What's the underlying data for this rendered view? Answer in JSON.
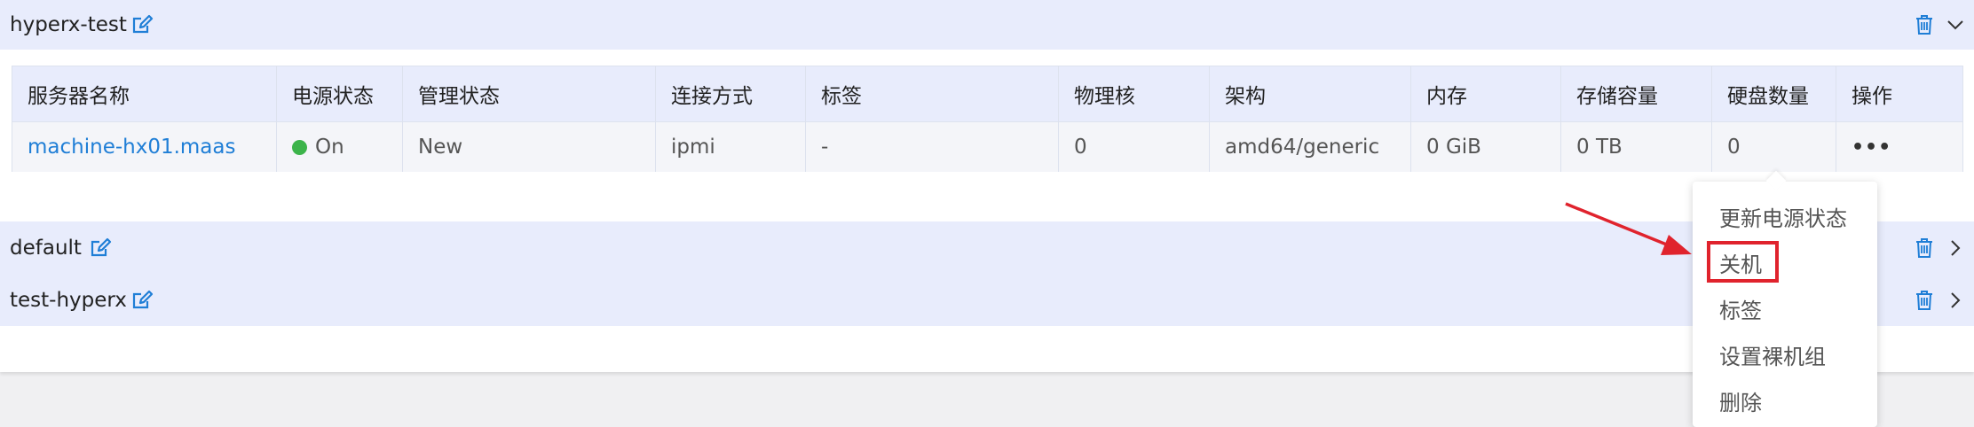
{
  "groups": [
    {
      "name": "hyperx-test",
      "expanded": true,
      "edit_icon": "edit-icon",
      "delete_icon": "trash-icon",
      "toggle_icon": "chevron-down-icon"
    },
    {
      "name": "default",
      "expanded": false,
      "edit_icon": "edit-icon",
      "delete_icon": "trash-icon",
      "toggle_icon": "chevron-right-icon"
    },
    {
      "name": "test-hyperx",
      "expanded": false,
      "edit_icon": "edit-icon",
      "delete_icon": "trash-icon",
      "toggle_icon": "chevron-right-icon"
    }
  ],
  "table": {
    "columns": [
      "服务器名称",
      "电源状态",
      "管理状态",
      "连接方式",
      "标签",
      "物理核",
      "架构",
      "内存",
      "存储容量",
      "硬盘数量",
      "操作"
    ],
    "rows": [
      {
        "server_name": "machine-hx01.maas",
        "power_state": "On",
        "manage_state": "New",
        "connection": "ipmi",
        "tags": "-",
        "physical_cores": "0",
        "arch": "amd64/generic",
        "memory": "0 GiB",
        "storage": "0 TB",
        "disk_count": "0",
        "actions": "•••"
      }
    ]
  },
  "action_menu": {
    "items": [
      "更新电源状态",
      "关机",
      "标签",
      "设置裸机组",
      "删除"
    ],
    "highlighted": "关机"
  },
  "colors": {
    "header_bg": "#e8ecfc",
    "link": "#1f7ed6",
    "power_on": "#3cb44b",
    "highlight": "#e0232d",
    "icon": "#1f7ed6"
  }
}
